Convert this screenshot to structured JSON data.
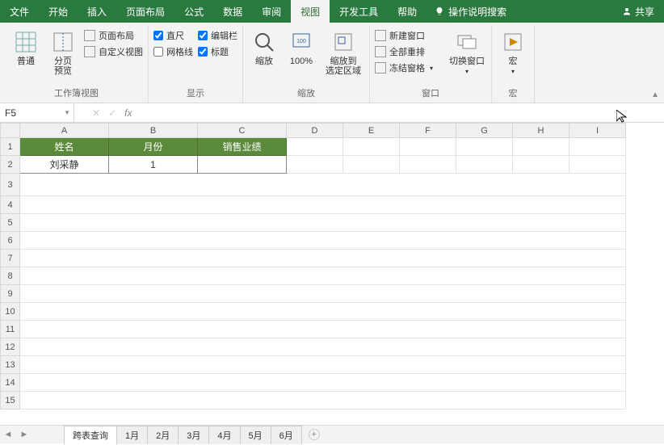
{
  "tabs": {
    "file": "文件",
    "home": "开始",
    "insert": "插入",
    "layout": "页面布局",
    "formula": "公式",
    "data": "数据",
    "review": "审阅",
    "view": "视图",
    "dev": "开发工具",
    "help": "帮助",
    "search_prompt": "操作说明搜索",
    "share": "共享"
  },
  "ribbon": {
    "group_views": "工作簿视图",
    "group_show": "显示",
    "group_zoom": "缩放",
    "group_window": "窗口",
    "group_macro": "宏",
    "normal": "普通",
    "page_break": "分页\n预览",
    "page_layout": "页面布局",
    "custom_view": "自定义视图",
    "ruler": "直尺",
    "formula_bar": "编辑栏",
    "gridlines": "网格线",
    "headings": "标题",
    "zoom": "缩放",
    "zoom100": "100%",
    "zoom_selection": "缩放到\n选定区域",
    "new_window": "新建窗口",
    "arrange": "全部重排",
    "freeze": "冻结窗格",
    "switch": "切换窗口",
    "macro": "宏"
  },
  "namebox": "F5",
  "headers": {
    "A": "姓名",
    "B": "月份",
    "C": "销售业绩"
  },
  "row2": {
    "A": "刘采静",
    "B": "1",
    "C": ""
  },
  "cols": [
    "A",
    "B",
    "C",
    "D",
    "E",
    "F",
    "G",
    "H",
    "I"
  ],
  "rows": [
    "1",
    "2",
    "3",
    "4",
    "5",
    "6",
    "7",
    "8",
    "9",
    "10",
    "11",
    "12",
    "13",
    "14",
    "15"
  ],
  "sheets": {
    "active": "跨表查询",
    "others": [
      "1月",
      "2月",
      "3月",
      "4月",
      "5月",
      "6月"
    ]
  },
  "chart_data": {
    "type": "table",
    "columns": [
      "姓名",
      "月份",
      "销售业绩"
    ],
    "rows": [
      [
        "刘采静",
        1,
        null
      ]
    ]
  }
}
